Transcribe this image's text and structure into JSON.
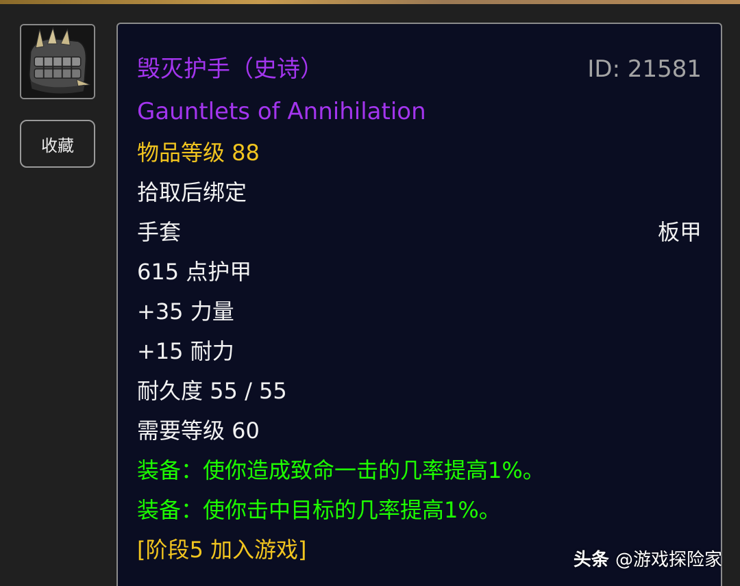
{
  "colors": {
    "epic": "#a335ee",
    "item_level": "#f2c51f",
    "equip_effect": "#1eff00",
    "panel_bg": "#0a0d22",
    "text": "#f2f2f2"
  },
  "icon": {
    "name": "gauntlets-icon"
  },
  "favorite_button": {
    "label": "收藏"
  },
  "item": {
    "name_cn": "毁灭护手（史诗）",
    "id_text": "ID: 21581",
    "name_en": "Gauntlets of Annihilation",
    "item_level": "物品等级 88",
    "bind": "拾取后绑定",
    "slot": "手套",
    "armor_type": "板甲",
    "armor": "615 点护甲",
    "stat_strength": "+35 力量",
    "stat_stamina": "+15 耐力",
    "durability": "耐久度 55 / 55",
    "required_level": "需要等级 60",
    "equip_1": "装备：使你造成致命一击的几率提高1%。",
    "equip_2": "装备：使你击中目标的几率提高1%。",
    "phase": "[阶段5 加入游戏]"
  },
  "watermark": {
    "brand": "头条",
    "handle": "@游戏探险家"
  }
}
